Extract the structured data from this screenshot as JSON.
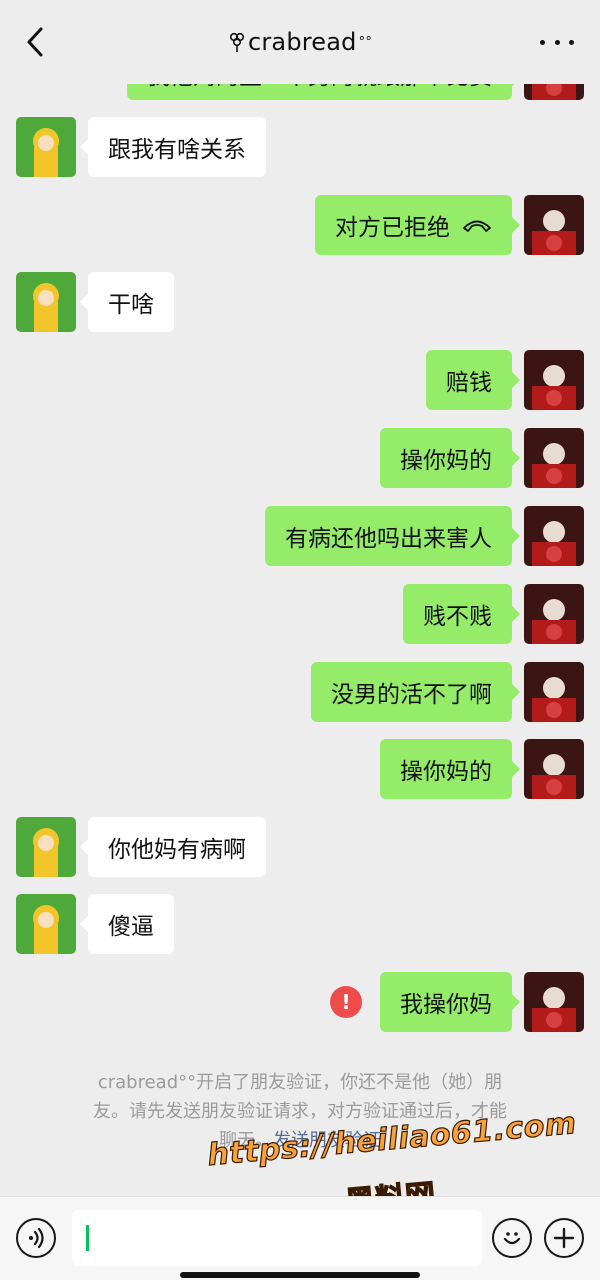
{
  "header": {
    "title": "crabread",
    "title_suffix": "°°",
    "back_icon": "chevron-left-icon",
    "more_icon": "more-dots-icon"
  },
  "messages": [
    {
      "side": "right",
      "text": "我他妈的至一个男的就跟那个比赛",
      "partial": true
    },
    {
      "side": "left",
      "text": "跟我有啥关系"
    },
    {
      "side": "right",
      "text": "对方已拒绝",
      "icon": "hangup-icon"
    },
    {
      "side": "left",
      "text": "干啥"
    },
    {
      "side": "right",
      "text": "赔钱"
    },
    {
      "side": "right",
      "text": "操你妈的"
    },
    {
      "side": "right",
      "text": "有病还他吗出来害人"
    },
    {
      "side": "right",
      "text": "贱不贱"
    },
    {
      "side": "right",
      "text": "没男的活不了啊"
    },
    {
      "side": "right",
      "text": "操你妈的"
    },
    {
      "side": "left",
      "text": "你他妈有病啊"
    },
    {
      "side": "left",
      "text": "傻逼"
    },
    {
      "side": "right",
      "text": "我操你妈",
      "failed": true
    }
  ],
  "notice": {
    "name": "crabread",
    "name_suffix": "°°",
    "line1": "开启了朋友验证，你还不是他（她）朋",
    "line2": "友。请先发送朋友验证请求，对方验证通过后，才能",
    "line3": "聊天。",
    "link": "发送朋友验证"
  },
  "watermark": {
    "url": "https://heiliao61.com",
    "text": "黑料网"
  },
  "input_bar": {
    "value": "",
    "voice_icon": "voice-icon",
    "emoji_icon": "emoji-icon",
    "plus_icon": "plus-icon"
  },
  "colors": {
    "background": "#ededed",
    "sent_bubble": "#95ec69",
    "received_bubble": "#ffffff",
    "error": "#f04b4b",
    "link": "#576b95"
  }
}
